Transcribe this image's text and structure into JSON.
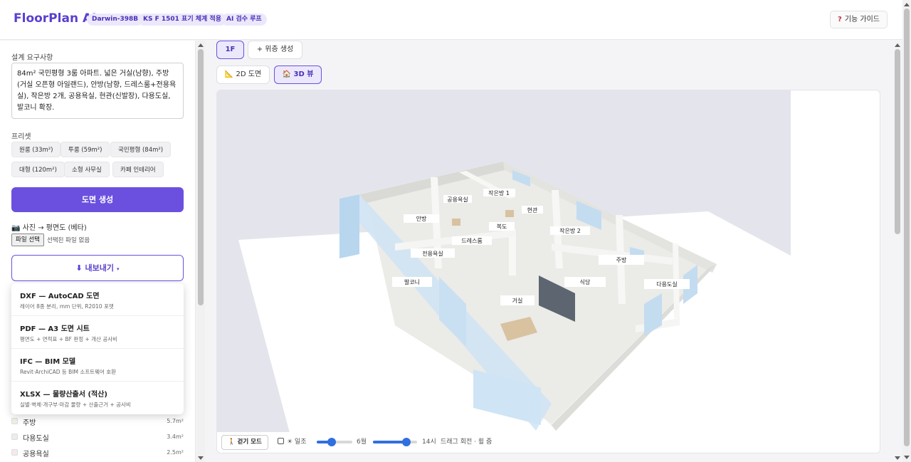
{
  "header": {
    "brand": "FloorPlan AI",
    "badges": [
      "Darwin-398B",
      "KS F 1501 표기 체계 적용",
      "AI 검수 루프"
    ],
    "guide_label": "기능 가이드",
    "guide_icon": "question-icon"
  },
  "sidebar": {
    "requirements_label": "설계 요구사항",
    "requirements_text": "84m² 국민평형 3룸 아파트. 넓은 거실(남향), 주방(거실 오픈형 아일랜드), 안방(남향, 드레스룸+전용욕실), 작은방 2개, 공용욕실, 현관(신발장), 다용도실, 발코니 확장.",
    "presets_label": "프리셋",
    "presets": [
      "원룸 (33m²)",
      "투룸 (59m²)",
      "국민평형 (84m²)",
      "대형 (120m²)",
      "소형 사무실",
      "카페 인테리어"
    ],
    "generate_label": "도면 생성",
    "photo_title": "📷 사진 → 평면도 (베타)",
    "file_button": "파일 선택",
    "file_status": "선택된 파일 없음",
    "export_label": "⬇ 내보내기",
    "export_caret": "▾",
    "export_options": [
      {
        "title": "DXF — AutoCAD 도면",
        "desc": "레이어 8종 분리, mm 단위, R2010 포맷"
      },
      {
        "title": "PDF — A3 도면 시트",
        "desc": "평면도 + 면적표 + BF 판정 + 개산 공사비"
      },
      {
        "title": "IFC — BIM 모델",
        "desc": "Revit·ArchiCAD 등 BIM 소프트웨어 호환"
      },
      {
        "title": "XLSX — 물량산출서 (적산)",
        "desc": "실별·벽체·개구부·마감 물량 + 산출근거 + 공사비"
      }
    ],
    "rooms": [
      {
        "name": "주방",
        "area": "5.7m²",
        "color": "#f1f0e2"
      },
      {
        "name": "다용도실",
        "area": "3.4m²",
        "color": "#ececec"
      },
      {
        "name": "공용욕실",
        "area": "2.5m²",
        "color": "#f6e9ee"
      }
    ]
  },
  "tabs": {
    "floors": [
      "1F",
      "+ 위층 생성"
    ],
    "views": [
      "📐 2D 도면",
      "🏠 3D 뷰"
    ]
  },
  "viewer": {
    "room_labels": [
      "공용욕실",
      "작은방 1",
      "현관",
      "안방",
      "복도",
      "작은방 2",
      "드레스룸",
      "전용욕실",
      "주방",
      "발코니",
      "식당",
      "다용도실",
      "거실"
    ]
  },
  "controls": {
    "walk_mode": "🚶 걷기 모드",
    "sun_label": "☀ 일조",
    "month_value": "6월",
    "hour_value": "14시",
    "hint": "드래그 회전 · 휠 줌",
    "month_fraction": 0.42,
    "hour_fraction": 0.75
  }
}
